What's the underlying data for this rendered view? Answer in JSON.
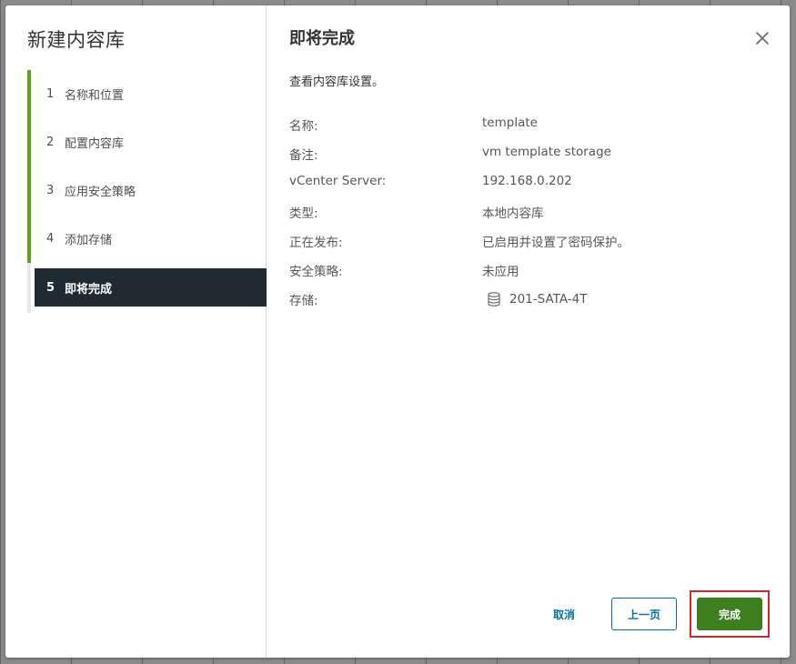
{
  "wizard": {
    "title": "新建内容库",
    "steps": [
      {
        "num": "1",
        "label": "名称和位置"
      },
      {
        "num": "2",
        "label": "配置内容库"
      },
      {
        "num": "3",
        "label": "应用安全策略"
      },
      {
        "num": "4",
        "label": "添加存储"
      },
      {
        "num": "5",
        "label": "即将完成"
      }
    ]
  },
  "content": {
    "title": "即将完成",
    "description": "查看内容库设置。",
    "summary": [
      {
        "label": "名称:",
        "value": "template"
      },
      {
        "label": "备注:",
        "value": "vm template storage"
      },
      {
        "label": "vCenter Server:",
        "value": "192.168.0.202"
      },
      {
        "label": "类型:",
        "value": "本地内容库"
      },
      {
        "label": "正在发布:",
        "value": "已启用并设置了密码保护。"
      },
      {
        "label": "安全策略:",
        "value": "未应用"
      },
      {
        "label": "存储:",
        "value": "201-SATA-4T",
        "icon": "database-icon"
      }
    ]
  },
  "footer": {
    "cancel_label": "取消",
    "back_label": "上一页",
    "finish_label": "完成"
  },
  "colors": {
    "accent_green": "#5aa220",
    "active_step_bg": "#1f2a33",
    "primary_button": "#3d7e1e",
    "link_blue": "#0072a3",
    "highlight_red": "#d0282d"
  }
}
